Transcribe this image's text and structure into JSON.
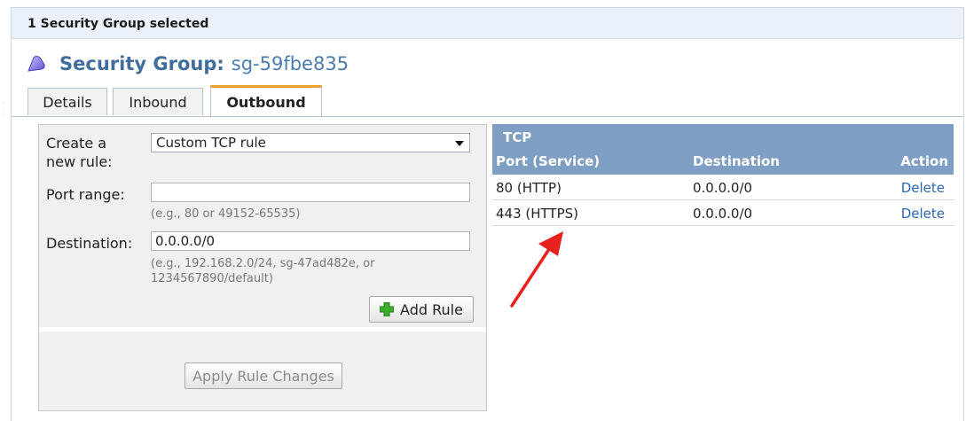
{
  "selection_bar": {
    "text": "1 Security Group selected"
  },
  "security_group": {
    "label": "Security Group:",
    "id": "sg-59fbe835"
  },
  "tabs": [
    {
      "label": "Details",
      "active": false
    },
    {
      "label": "Inbound",
      "active": false
    },
    {
      "label": "Outbound",
      "active": true
    }
  ],
  "form": {
    "create_rule_label": "Create a new rule:",
    "rule_type_value": "Custom TCP rule",
    "port_range_label": "Port range:",
    "port_range_value": "",
    "port_range_hint": "(e.g., 80 or 49152-65535)",
    "destination_label": "Destination:",
    "destination_value": "0.0.0.0/0",
    "destination_hint_line1": "(e.g., 192.168.2.0/24, sg-47ad482e, or",
    "destination_hint_line2": "1234567890/default)",
    "add_rule_button": "Add Rule",
    "apply_button": "Apply Rule Changes"
  },
  "rules_table": {
    "protocol": "TCP",
    "columns": [
      "Port (Service)",
      "Destination",
      "Action"
    ],
    "rows": [
      {
        "port": "80 (HTTP)",
        "destination": "0.0.0.0/0",
        "action": "Delete"
      },
      {
        "port": "443 (HTTPS)",
        "destination": "0.0.0.0/0",
        "action": "Delete"
      }
    ]
  },
  "colors": {
    "table_header": "#7f9ec3",
    "link": "#2a66b3",
    "annotation_arrow": "#e8211c",
    "tab_accent": "#f0a12a"
  }
}
